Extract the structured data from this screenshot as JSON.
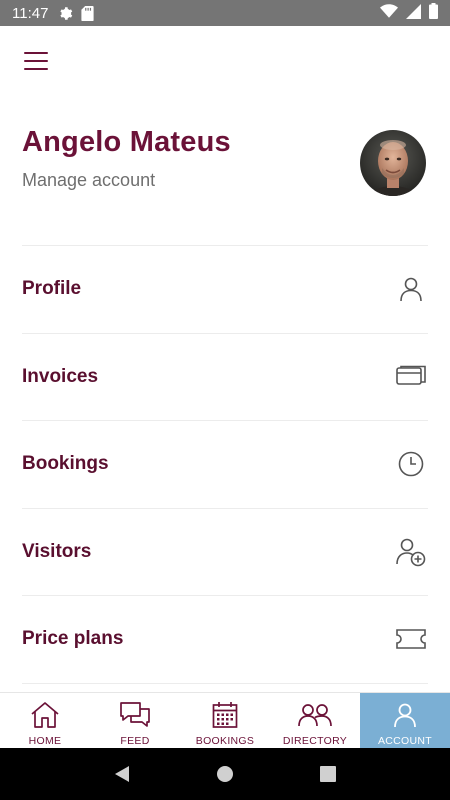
{
  "status_bar": {
    "time": "11:47",
    "icons": [
      "settings-icon",
      "sd-card-icon",
      "wifi-icon",
      "signal-icon",
      "battery-icon"
    ]
  },
  "header": {
    "menu_icon": "hamburger-menu-icon"
  },
  "user": {
    "name": "Angelo Mateus",
    "manage_label": "Manage account"
  },
  "menu": {
    "items": [
      {
        "label": "Profile",
        "icon": "person-icon"
      },
      {
        "label": "Invoices",
        "icon": "cards-icon"
      },
      {
        "label": "Bookings",
        "icon": "clock-icon"
      },
      {
        "label": "Visitors",
        "icon": "person-add-icon"
      },
      {
        "label": "Price plans",
        "icon": "ticket-icon"
      }
    ]
  },
  "bottom_nav": {
    "tabs": [
      {
        "label": "HOME",
        "icon": "home-icon",
        "active": false
      },
      {
        "label": "FEED",
        "icon": "chat-icon",
        "active": false
      },
      {
        "label": "BOOKINGS",
        "icon": "calendar-icon",
        "active": false
      },
      {
        "label": "DIRECTORY",
        "icon": "people-icon",
        "active": false
      },
      {
        "label": "ACCOUNT",
        "icon": "person-icon",
        "active": true
      }
    ]
  },
  "colors": {
    "brand": "#6b1238",
    "active_tab": "#7bafd4",
    "status_bar": "#757575"
  }
}
